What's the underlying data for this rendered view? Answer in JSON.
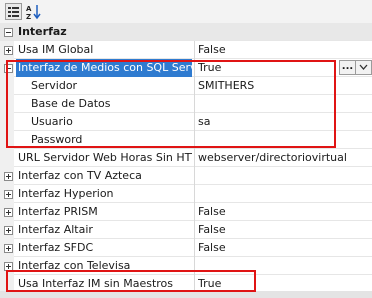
{
  "toolbar": {
    "categorized_icon": "categorized-view-icon",
    "sort_icon": "alphabetical-sort-icon"
  },
  "category": {
    "label": "Interfaz"
  },
  "rows": [
    {
      "name": "Usa IM Global",
      "value": "False"
    },
    {
      "name": "Interfaz de Medios con SQL Server",
      "value": "True"
    },
    {
      "name": "Servidor",
      "value": "SMITHERS"
    },
    {
      "name": "Base de Datos",
      "value": ""
    },
    {
      "name": "Usuario",
      "value": "sa"
    },
    {
      "name": "Password",
      "value": ""
    },
    {
      "name": "URL Servidor Web Horas Sin HTTP://",
      "value": "webserver/directoriovirtual"
    },
    {
      "name": "Interfaz con TV Azteca",
      "value": ""
    },
    {
      "name": "Interfaz Hyperion",
      "value": ""
    },
    {
      "name": "Interfaz PRISM",
      "value": "False"
    },
    {
      "name": "Interfaz Altair",
      "value": "False"
    },
    {
      "name": "Interfaz SFDC",
      "value": "False"
    },
    {
      "name": "Interfaz con Televisa",
      "value": ""
    },
    {
      "name": "Usa Interfaz IM sin Maestros",
      "value": "True"
    }
  ],
  "editor": {
    "ellipsis_label": "...",
    "dropdown_icon": "chevron-down-icon"
  },
  "colors": {
    "highlight_border": "#e01414",
    "selection": "#2f7bd0"
  }
}
